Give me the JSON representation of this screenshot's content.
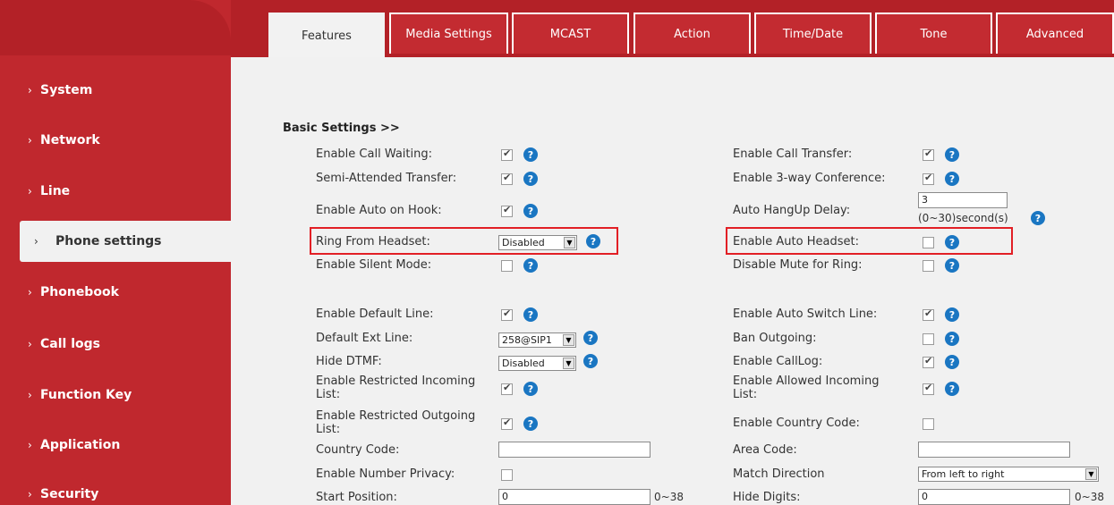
{
  "sidebar": {
    "items": [
      {
        "label": "System"
      },
      {
        "label": "Network"
      },
      {
        "label": "Line"
      },
      {
        "label": "Phone settings"
      },
      {
        "label": "Phonebook"
      },
      {
        "label": "Call logs"
      },
      {
        "label": "Function Key"
      },
      {
        "label": "Application"
      },
      {
        "label": "Security"
      }
    ],
    "active": "Phone settings"
  },
  "tabs": [
    {
      "label": "Features"
    },
    {
      "label": "Media Settings"
    },
    {
      "label": "MCAST"
    },
    {
      "label": "Action"
    },
    {
      "label": "Time/Date"
    },
    {
      "label": "Tone"
    },
    {
      "label": "Advanced"
    }
  ],
  "section_title": "Basic Settings >>",
  "left_fields": {
    "call_waiting": {
      "label": "Enable Call Waiting:",
      "checked": true
    },
    "semi_attended": {
      "label": "Semi-Attended Transfer:",
      "checked": true
    },
    "auto_on_hook": {
      "label": "Enable Auto on Hook:",
      "checked": true
    },
    "ring_from_headset": {
      "label": "Ring From Headset:",
      "value": "Disabled"
    },
    "silent_mode": {
      "label": "Enable Silent Mode:",
      "checked": false
    },
    "default_line": {
      "label": "Enable Default Line:",
      "checked": true
    },
    "default_ext_line": {
      "label": "Default Ext Line:",
      "value": "258@SIP1"
    },
    "hide_dtmf": {
      "label": "Hide DTMF:",
      "value": "Disabled"
    },
    "restricted_incoming": {
      "label_1": "Enable Restricted Incoming",
      "label_2": "List:",
      "checked": true
    },
    "restricted_outgoing": {
      "label_1": "Enable Restricted Outgoing",
      "label_2": "List:",
      "checked": true
    },
    "country_code": {
      "label": "Country Code:",
      "value": ""
    },
    "number_privacy": {
      "label": "Enable Number Privacy:",
      "checked": false
    },
    "start_position": {
      "label": "Start Position:",
      "value": "0",
      "hint": "0~38"
    }
  },
  "right_fields": {
    "call_transfer": {
      "label": "Enable Call Transfer:",
      "checked": true
    },
    "three_way": {
      "label": "Enable 3-way Conference:",
      "checked": true
    },
    "auto_hangup": {
      "label": "Auto HangUp Delay:",
      "value": "3",
      "hint": "(0~30)second(s)"
    },
    "auto_headset": {
      "label": "Enable Auto Headset:",
      "checked": false
    },
    "mute_for_ring": {
      "label": "Disable Mute for Ring:",
      "checked": false
    },
    "auto_switch_line": {
      "label": "Enable Auto Switch Line:",
      "checked": true
    },
    "ban_outgoing": {
      "label": "Ban Outgoing:",
      "checked": false
    },
    "call_log": {
      "label": "Enable CallLog:",
      "checked": true
    },
    "allowed_incoming": {
      "label_1": "Enable Allowed Incoming",
      "label_2": "List:",
      "checked": true
    },
    "country_code_enable": {
      "label": "Enable Country Code:",
      "checked": false
    },
    "area_code": {
      "label": "Area Code:",
      "value": ""
    },
    "match_direction": {
      "label": "Match Direction",
      "value": "From left to right"
    },
    "hide_digits": {
      "label": "Hide Digits:",
      "value": "0",
      "hint": "0~38"
    }
  },
  "help_glyph": "?",
  "colors": {
    "brand": "#c0282e",
    "highlight": "#e21f25",
    "help": "#1a76c2"
  }
}
